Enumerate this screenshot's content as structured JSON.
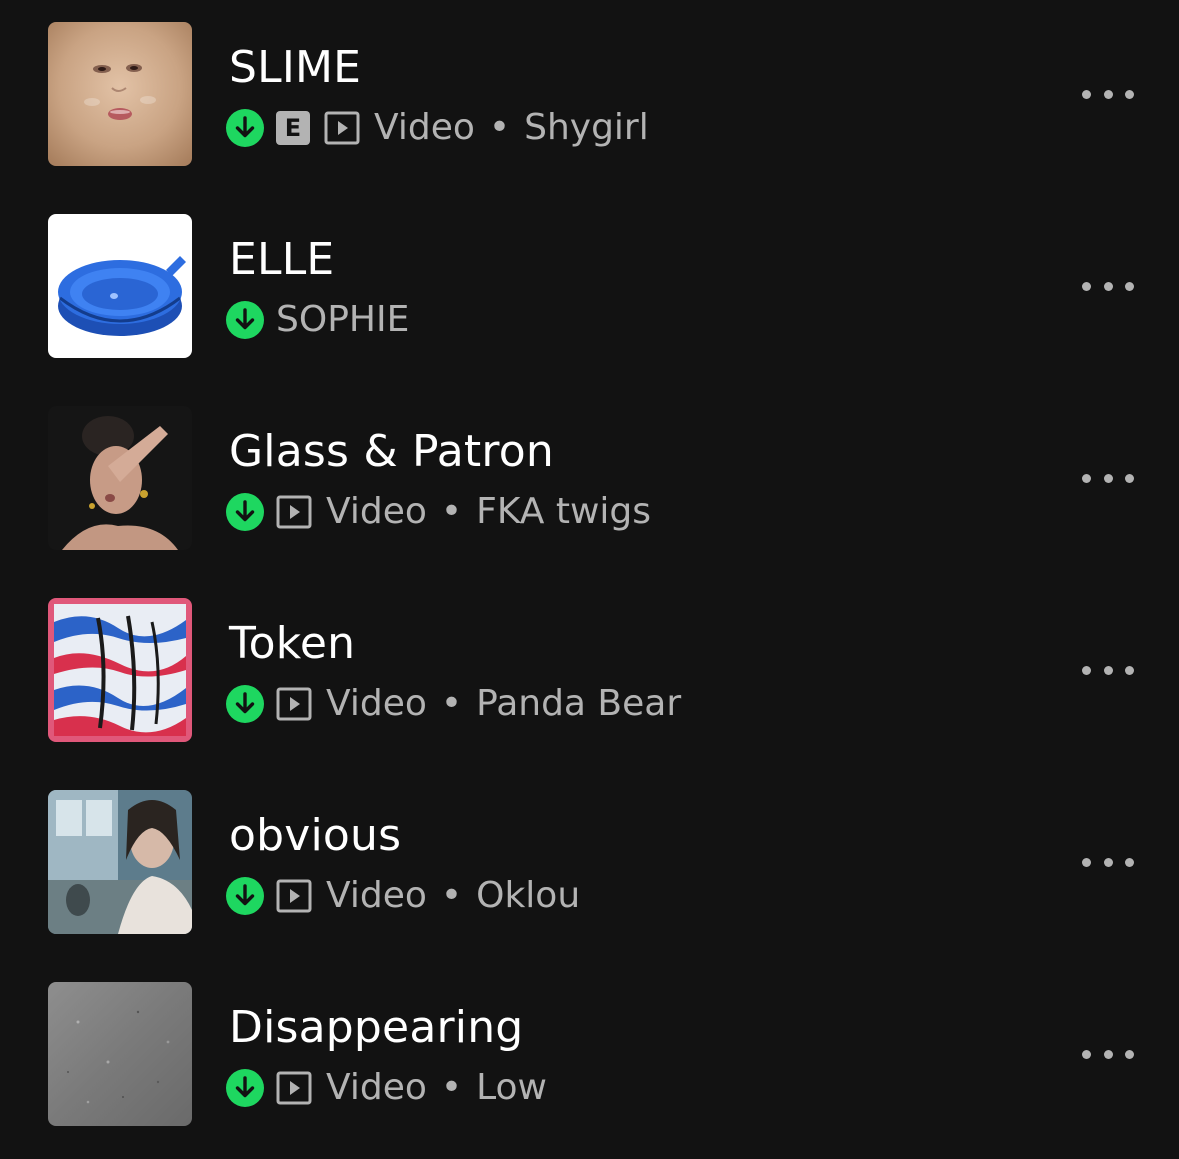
{
  "colors": {
    "background": "#121212",
    "title": "#ffffff",
    "secondary": "#b3b3b3",
    "download_green": "#1ed760"
  },
  "icons": {
    "download": "download-complete-icon",
    "explicit": "explicit-badge",
    "video": "video-icon",
    "more": "more-options-icon"
  },
  "tracks": [
    {
      "title": "SLIME",
      "explicit": true,
      "explicit_label": "E",
      "type_label": "Video",
      "separator": "•",
      "artist": "Shygirl"
    },
    {
      "title": "ELLE",
      "explicit": false,
      "artist": "SOPHIE"
    },
    {
      "title": "Glass & Patron",
      "explicit": false,
      "type_label": "Video",
      "separator": "•",
      "artist": "FKA twigs"
    },
    {
      "title": "Token",
      "explicit": false,
      "type_label": "Video",
      "separator": "•",
      "artist": "Panda Bear"
    },
    {
      "title": "obvious",
      "explicit": false,
      "type_label": "Video",
      "separator": "•",
      "artist": "Oklou"
    },
    {
      "title": "Disappearing",
      "explicit": false,
      "type_label": "Video",
      "separator": "•",
      "artist": "Low"
    }
  ]
}
